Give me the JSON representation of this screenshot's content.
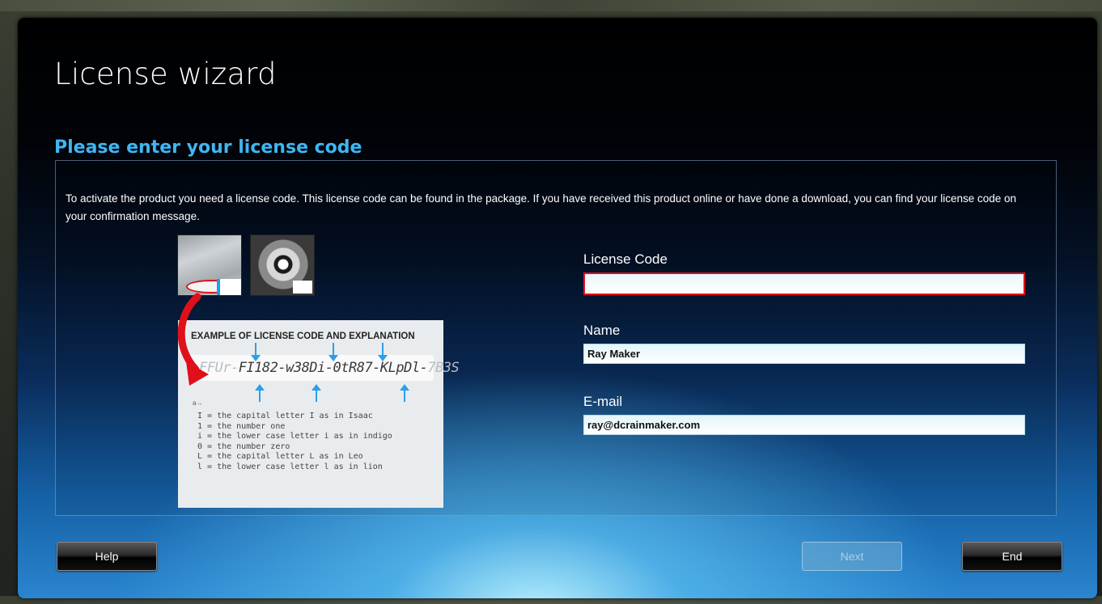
{
  "window": {
    "title": "License wizard",
    "subtitle": "Please enter your license code"
  },
  "intro_text": "To activate the product you need a license code. This license code can be found in the package. If you have received this product online or have done a download, you can find your license code on your confirmation message.",
  "example": {
    "heading": "EXAMPLE OF LICENSE CODE AND EXPLANATION",
    "code_faded_start": "FFUr-",
    "code_main": "FI182-w38Di-0tR87-KLpDl-",
    "code_faded_end": "7B3S",
    "mark": "a→",
    "legend": [
      "I = the capital letter I as in Isaac",
      "1 = the number one",
      "i = the lower case letter i as in indigo",
      "0 = the number zero",
      "L = the capital letter L as in Leo",
      "l = the lower case letter l as in lion"
    ]
  },
  "form": {
    "license_label": "License Code",
    "license_value": "",
    "name_label": "Name",
    "name_value": "Ray Maker",
    "email_label": "E-mail",
    "email_value": "ray@dcrainmaker.com"
  },
  "buttons": {
    "help": "Help",
    "next": "Next",
    "end": "End"
  },
  "colors": {
    "accent": "#3fb6f2",
    "error_border": "#e0101a"
  }
}
